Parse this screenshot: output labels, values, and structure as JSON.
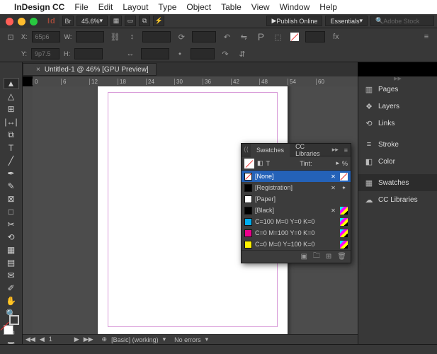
{
  "menubar": {
    "apple": "",
    "app": "InDesign CC",
    "items": [
      "File",
      "Edit",
      "Layout",
      "Type",
      "Object",
      "Table",
      "View",
      "Window",
      "Help"
    ]
  },
  "ctrlbar": {
    "bridge_icon": "Br",
    "zoom": "45.6%",
    "publish": "Publish Online",
    "workspace": "Essentials",
    "search_placeholder": "Adobe Stock"
  },
  "optbar": {
    "x_label": "X:",
    "x_val": "65p6",
    "y_label": "Y:",
    "y_val": "9p7.5",
    "w_label": "W:",
    "w_val": "",
    "h_label": "H:",
    "h_val": ""
  },
  "document": {
    "tab_title": "Untitled-1 @ 46% [GPU Preview]"
  },
  "ruler_ticks": [
    "0",
    "6",
    "12",
    "18",
    "24",
    "30",
    "36",
    "42",
    "48",
    "54",
    "60"
  ],
  "tools": [
    {
      "name": "selection-tool",
      "glyph": "▴"
    },
    {
      "name": "direct-selection-tool",
      "glyph": "▵"
    },
    {
      "name": "page-tool",
      "glyph": "⊞"
    },
    {
      "name": "gap-tool",
      "glyph": "↔"
    },
    {
      "name": "content-collector-tool",
      "glyph": "⧉"
    },
    {
      "name": "type-tool",
      "glyph": "T"
    },
    {
      "name": "line-tool",
      "glyph": "╱"
    },
    {
      "name": "pen-tool",
      "glyph": "✒"
    },
    {
      "name": "pencil-tool",
      "glyph": "✎"
    },
    {
      "name": "rectangle-frame-tool",
      "glyph": "⊠"
    },
    {
      "name": "rectangle-tool",
      "glyph": "□"
    },
    {
      "name": "scissors-tool",
      "glyph": "✂"
    },
    {
      "name": "free-transform-tool",
      "glyph": "⟲"
    },
    {
      "name": "gradient-swatch-tool",
      "glyph": "▦"
    },
    {
      "name": "gradient-feather-tool",
      "glyph": "▤"
    },
    {
      "name": "note-tool",
      "glyph": "�окум"
    },
    {
      "name": "eyedropper-tool",
      "glyph": "✐"
    },
    {
      "name": "hand-tool",
      "glyph": "✋"
    },
    {
      "name": "zoom-tool",
      "glyph": "🔍"
    }
  ],
  "dock": {
    "items": [
      {
        "icon": "▥",
        "label": "Pages",
        "name": "pages-panel"
      },
      {
        "icon": "❖",
        "label": "Layers",
        "name": "layers-panel"
      },
      {
        "icon": "⟲",
        "label": "Links",
        "name": "links-panel"
      }
    ],
    "items2": [
      {
        "icon": "≡",
        "label": "Stroke",
        "name": "stroke-panel"
      },
      {
        "icon": "◧",
        "label": "Color",
        "name": "color-panel"
      }
    ],
    "items3": [
      {
        "icon": "▦",
        "label": "Swatches",
        "name": "swatches-panel",
        "sel": true
      },
      {
        "icon": "☁",
        "label": "CC Libraries",
        "name": "cc-libraries-panel"
      }
    ]
  },
  "swatches": {
    "tab1": "Swatches",
    "tab2": "CC Libraries",
    "tint_label": "Tint:",
    "tint_unit": "%",
    "rows": [
      {
        "color": "none",
        "name": "[None]",
        "lock": true,
        "none_badge": true,
        "sel": true
      },
      {
        "color": "#000",
        "name": "[Registration]",
        "lock": true,
        "reg": true
      },
      {
        "color": "#fff",
        "name": "[Paper]"
      },
      {
        "color": "#000",
        "name": "[Black]",
        "lock": true,
        "cmyk": true
      },
      {
        "color": "#00AEEF",
        "name": "C=100 M=0 Y=0 K=0",
        "cmyk": true
      },
      {
        "color": "#EC008C",
        "name": "C=0 M=100 Y=0 K=0",
        "cmyk": true
      },
      {
        "color": "#FFF200",
        "name": "C=0 M=0 Y=100 K=0",
        "cmyk": true
      }
    ]
  },
  "status": {
    "page": "1",
    "preset": "[Basic] (working)",
    "errors": "No errors"
  }
}
